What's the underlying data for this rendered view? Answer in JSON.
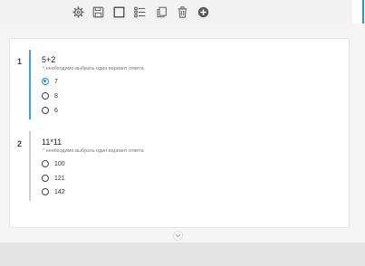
{
  "toolbar": {
    "icons": [
      "gear-icon",
      "save-icon",
      "square-icon",
      "list-checks-icon",
      "copy-icon",
      "trash-icon",
      "add-circle-icon"
    ]
  },
  "colors": {
    "accent": "#2d8fc9",
    "active_line": "#3aa6d9",
    "inactive_line": "#cfcfcf"
  },
  "questions": [
    {
      "number": "1",
      "title": "5+2",
      "hint": "* необходимо выбрать один вариант ответа",
      "options": [
        {
          "label": "7",
          "selected": true
        },
        {
          "label": "8",
          "selected": false
        },
        {
          "label": "6",
          "selected": false
        }
      ]
    },
    {
      "number": "2",
      "title": "11*11",
      "hint": "* необходимо выбрать один вариант ответа",
      "options": [
        {
          "label": "100",
          "selected": false
        },
        {
          "label": "121",
          "selected": false
        },
        {
          "label": "142",
          "selected": false
        }
      ]
    }
  ]
}
